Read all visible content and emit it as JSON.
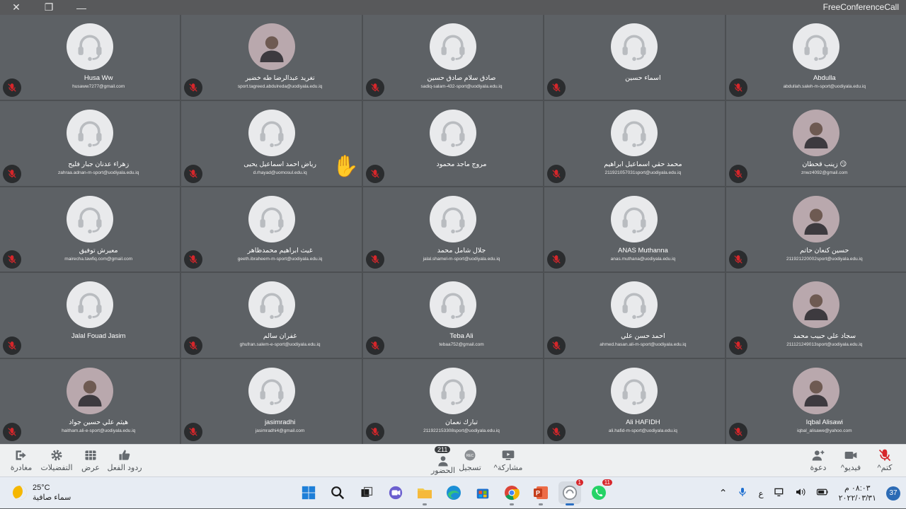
{
  "window": {
    "title": "FreeConferenceCall",
    "close_icon": "✕",
    "restore_icon": "❐",
    "minimize_icon": "—"
  },
  "participants": [
    {
      "name": "Husa Ww",
      "email": "husaww7277@gmail.com",
      "avatar": "headset"
    },
    {
      "name": "تغريد عبدالرضا طه خضير",
      "email": "sport.tagreed.abdulreda@uodiyala.edu.iq",
      "avatar": "photo"
    },
    {
      "name": "صادق سلام صادق حسين",
      "email": "sadiq-salam-432-sport@uodiyala.edu.iq",
      "avatar": "headset"
    },
    {
      "name": "اسماء حسين",
      "email": "",
      "avatar": "headset"
    },
    {
      "name": "Abdulla",
      "email": "abdullah.saleh-m-sport@uodiyala.edu.iq",
      "avatar": "headset"
    },
    {
      "name": "زهراء عدنان جبار فليح",
      "email": "zahraa.adnan-m-sport@uodiyala.edu.iq",
      "avatar": "headset"
    },
    {
      "name": "رياض احمد اسماعيل يحيى",
      "email": "d.rhayad@uomosul.edu.iq",
      "avatar": "headset",
      "hand": "✋"
    },
    {
      "name": "مروج ماجد محمود",
      "email": "",
      "avatar": "headset"
    },
    {
      "name": "محمد حقي اسماعيل ابراهيم",
      "email": "211921057031sport@uodiyala.edu.iq",
      "avatar": "headset"
    },
    {
      "name": "زينب قحطان 😏",
      "email": "znwz4092@gmail.com",
      "avatar": "photo"
    },
    {
      "name": "معيرش توفيق",
      "email": "mairecha.tawfiq.com@gmail.com",
      "avatar": "headset"
    },
    {
      "name": "غيث ابراهيم محمدظاهر",
      "email": "geeth.ibraheem-m-sport@uodiyala.edu.iq",
      "avatar": "headset"
    },
    {
      "name": "جلال شامل محمد",
      "email": "jalal.shamel-m-sport@uodiyala.edu.iq",
      "avatar": "headset"
    },
    {
      "name": "ANAS Muthanna",
      "email": "anas.muthana@uodiyala.edu.iq",
      "avatar": "headset"
    },
    {
      "name": "حسين كنعان حاتم",
      "email": "211921220002sport@uodiyala.edu.iq",
      "avatar": "photo"
    },
    {
      "name": "Jalal Fouad Jasim",
      "email": "",
      "avatar": "headset"
    },
    {
      "name": "غفران سالم",
      "email": "ghufran.salem-e-sport@uodiyala.edu.iq",
      "avatar": "headset"
    },
    {
      "name": "Teba Ali",
      "email": "tebaa752@gmail.com",
      "avatar": "headset"
    },
    {
      "name": "احمد حسن علي",
      "email": "ahmed.hasan.ali-m-sport@uodiyala.edu.iq",
      "avatar": "headset"
    },
    {
      "name": "سجاد علي حبيب محمد",
      "email": "211121249013sport@uodiyala.edu.iq",
      "avatar": "photo"
    },
    {
      "name": "هيثم علي حسين جواد",
      "email": "haitham.ali-e-sport@uodiyala.edu.iq",
      "avatar": "photo"
    },
    {
      "name": "jasimradhi",
      "email": "jasimradhi4@gmail.com",
      "avatar": "headset"
    },
    {
      "name": "تبارك نعمان",
      "email": "211922153308sport@uodiyala.edu.iq",
      "avatar": "headset"
    },
    {
      "name": "Ali HAFIDH",
      "email": "ali.hafid-m-sport@uodiyala.edu.iq",
      "avatar": "headset"
    },
    {
      "name": "Iqbal Alisawi",
      "email": "iqbal_alisawe@yahoo.com",
      "avatar": "photo"
    }
  ],
  "toolbar": {
    "leave": "مغادرة",
    "preferences": "التفضيلات",
    "view": "عرض",
    "reactions": "ردود الفعل",
    "attendance": "الحضور",
    "attendance_count": "211",
    "record": "تسجيل",
    "record_badge": "REC",
    "share": "مشاركة",
    "invite": "دعوة",
    "video": "فيديو",
    "mute": "كتم"
  },
  "taskbar": {
    "temperature": "25°C",
    "weather_desc": "سماء صافية",
    "whatsapp_badge": "11",
    "chrome_badge": "1",
    "lang": "ع",
    "time": "٠٨:٠٣ م",
    "date": "٢٠٢٢/٠٣/٣١",
    "notifications": "37"
  },
  "colors": {
    "tile_bg": "#5d6165",
    "mic_muted": "#d6262b",
    "toolbar_bg": "#eef0f1"
  }
}
